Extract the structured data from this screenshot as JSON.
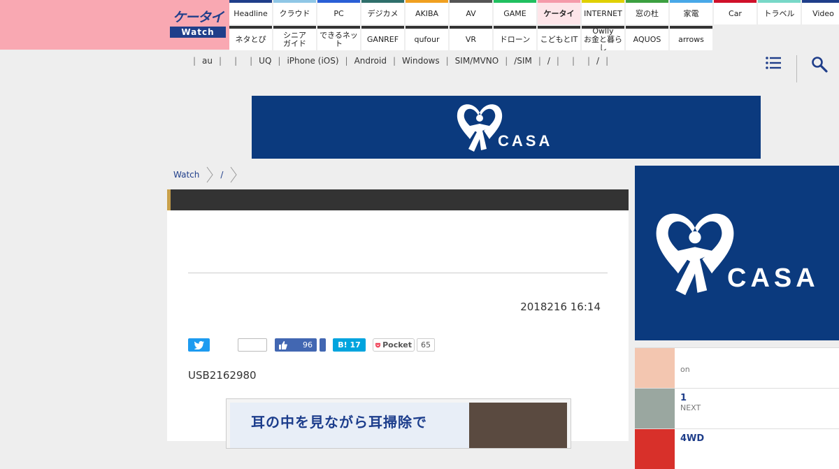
{
  "logo": {
    "top": "ケータイ",
    "bottom": "Watch"
  },
  "nav": {
    "row1": [
      {
        "label": "Headline",
        "color": "#1f3e8a"
      },
      {
        "label": "クラウド",
        "color": "#8fc7e6"
      },
      {
        "label": "PC",
        "color": "#2a5fd6"
      },
      {
        "label": "デジカメ",
        "color": "#2f6f6b"
      },
      {
        "label": "AKIBA",
        "color": "#f0a020"
      },
      {
        "label": "AV",
        "color": "#555555"
      },
      {
        "label": "GAME",
        "color": "#20c060"
      },
      {
        "label": "ケータイ",
        "color": "#f59aaa",
        "active": true
      },
      {
        "label": "INTERNET",
        "color": "#e0d000"
      },
      {
        "label": "窓の杜",
        "color": "#3ca040"
      },
      {
        "label": "家電",
        "color": "#48a8e8"
      },
      {
        "label": "Car",
        "color": "#d0102a"
      },
      {
        "label": "トラベル",
        "color": "#78d8c8"
      },
      {
        "label": "Video",
        "color": "#1f3e8a"
      }
    ],
    "row2": [
      {
        "label": "ネタとぴ",
        "color": "#333333"
      },
      {
        "label": "シニア\nガイド",
        "color": "#333333"
      },
      {
        "label": "できるネット",
        "color": "#333333"
      },
      {
        "label": "GANREF",
        "color": "#333333"
      },
      {
        "label": "qufour",
        "color": "#333333"
      },
      {
        "label": "VR",
        "color": "#333333"
      },
      {
        "label": "ドローン",
        "color": "#333333"
      },
      {
        "label": "こどもとIT",
        "color": "#333333"
      },
      {
        "label": "Owlly\nお金と暮らし",
        "color": "#333333"
      },
      {
        "label": "AQUOS",
        "color": "#333333"
      },
      {
        "label": "arrows",
        "color": "#333333"
      }
    ]
  },
  "subnav": [
    "",
    "au",
    "",
    "",
    "UQ",
    "iPhone (iOS)",
    "Android",
    "Windows",
    "SIM/MVNO",
    "/SIM",
    "/",
    "",
    "",
    "/",
    ""
  ],
  "banner": {
    "text": "CASA"
  },
  "side_ad": {
    "text": "CASA"
  },
  "breadcrumb": [
    "Watch",
    "/"
  ],
  "article": {
    "date": "2018216 16:14",
    "share": {
      "fb_count": "96",
      "hb_label": "B!",
      "hb_count": "17",
      "pocket_label": "Pocket",
      "pocket_count": "65"
    },
    "lead": "USB2162980",
    "image_text": "耳の中を見ながら耳掃除で"
  },
  "side_list": [
    {
      "title": "",
      "sub": "on"
    },
    {
      "title": "1",
      "sub": "NEXT"
    },
    {
      "title": "4WD",
      "sub": ""
    }
  ],
  "colors": {
    "brand": "#1f3e8a",
    "logo_bg": "#f9a8b2",
    "ad_bg": "#0b3a7e"
  }
}
